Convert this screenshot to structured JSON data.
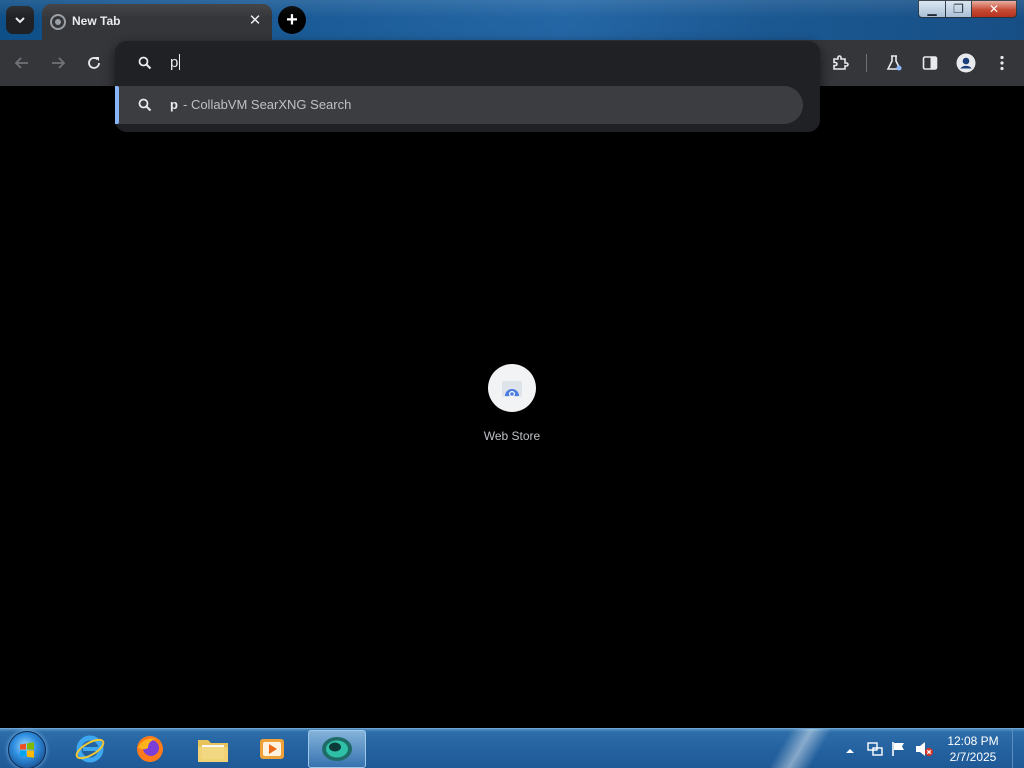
{
  "browser": {
    "tab": {
      "title": "New Tab"
    },
    "omnibox": {
      "input_value": "p",
      "suggestion": {
        "query": "p",
        "description": "- CollabVM SearXNG Search"
      }
    },
    "shortcuts": [
      {
        "label": "Web Store"
      }
    ],
    "colors": {
      "toolbar": "#35363a",
      "omnibox": "#202124",
      "accent": "#8ab4f8",
      "page": "#000000"
    }
  },
  "taskbar": {
    "pinned": [
      "internet-explorer-icon",
      "firefox-icon",
      "file-explorer-icon",
      "media-player-icon",
      "chrome-app-icon"
    ],
    "clock": {
      "time": "12:08 PM",
      "date": "2/7/2025"
    }
  }
}
